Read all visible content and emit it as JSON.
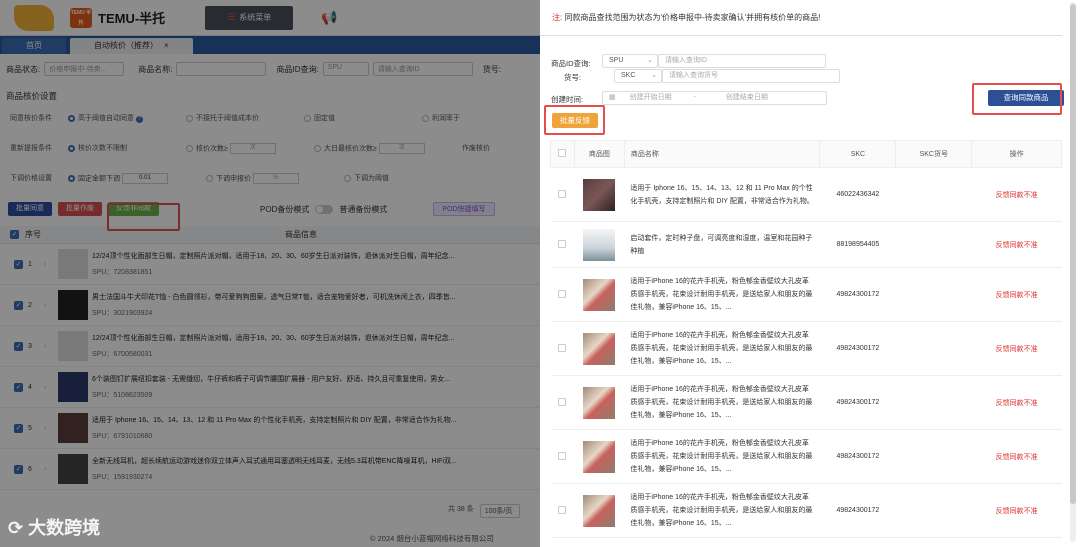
{
  "app": {
    "brand": "TEMU-半托",
    "logo_small": "TEMU 半托",
    "system_menu": "系统菜单",
    "tabs": [
      {
        "label": "首页"
      },
      {
        "label": "自动核价（推荐）",
        "close": "×"
      }
    ],
    "filters": {
      "status_label": "商品状态:",
      "status_value": "价格申报中-待卖...",
      "name_label": "商品名称:",
      "id_label": "商品ID查询:",
      "id_type": "SPU",
      "id_placeholder": "请输入查询ID",
      "sku_label": "货号:"
    },
    "settings_title": "商品核价设置",
    "config_rows": [
      {
        "label": "同意核价条件",
        "options": [
          "高于阈值自动同意",
          "不接托于阈值成本价",
          "固定值",
          "利润率于"
        ]
      },
      {
        "label": "重新提报条件",
        "options": [
          "核价次数不限制",
          "核价次数≥",
          "次",
          "大日最核价次数≥",
          "次",
          "作废核价"
        ]
      },
      {
        "label": "下调价格设置",
        "options": [
          "固定金额下调",
          "0.01",
          "下调申报价",
          "%",
          "下调为阈值"
        ]
      }
    ],
    "buttons": {
      "bulk_agree": "批量同意",
      "bulk_void": "批量作废",
      "feedback_same": "反馈非同款",
      "pod_mode_label": "POD备份模式",
      "normal_mode_label": "普通备份模式",
      "pod_quick": "POD快捷填写"
    },
    "table_head": {
      "index": "序号",
      "info": "商品信息"
    },
    "rows": [
      {
        "idx": "1",
        "title": "12/24顶个性化面部生日帽，定制照片派对帽，适用于18、20、30、60岁生日派对装饰，退休派对生日帽，周年纪念...",
        "spu": "SPU：7208381851"
      },
      {
        "idx": "2",
        "title": "男士法国斗牛犬印花T恤 - 白色圆领衫，带可爱狗狗图案，透气日常T恤，适合宠物爱好者，可机洗休闲上衣，四季皆...",
        "spu": "SPU：3021903924"
      },
      {
        "idx": "3",
        "title": "12/24顶个性化面部生日帽，定制照片派对帽，适用于18、20、30、60岁生日派对装饰，退休派对生日帽，周年纪念...",
        "spu": "SPU：6700580031"
      },
      {
        "idx": "4",
        "title": "6个装图钉扩展纽扣套装 - 无需缝纫，牛仔裤和裤子可调节腰围扩展器 - 用户友好、舒适、持久且可重复使用，男女...",
        "spu": "SPU：5108623509"
      },
      {
        "idx": "5",
        "title": "适用于 Iphone 16、15、14、13、12 和 11 Pro Max 的个性化手机壳，支持定制照片和 DIY 配置，非常适合作为礼物...",
        "spu": "SPU：6791010680"
      },
      {
        "idx": "6",
        "title": "全新无线耳机，超长续航运动游戏迷你双立体声入耳式通用耳塞透明无线耳麦，无线5.3耳机带ENC降噪耳机，HiFi双...",
        "spu": "SPU：1591930274"
      }
    ],
    "pager": {
      "total": "共 38 条",
      "per_page": "100条/页"
    },
    "footer": "© 2024 烟台小蓝帽网络科技有限公司",
    "watermark": "大数跨境"
  },
  "modal": {
    "note_prefix": "注:",
    "note": "同款商品查找范围为状态为'价格申报中-待卖家确认'并拥有核价单的商品!",
    "id_label": "商品ID查询:",
    "id_type": "SPU",
    "id_placeholder": "请输入查询ID",
    "sku_label": "货号:",
    "sku_type": "SKC",
    "sku_placeholder": "请输入查询货号",
    "created_label": "创建时间:",
    "start_placeholder": "创建开始日期",
    "range_sep": "-",
    "end_placeholder": "创建结束日期",
    "query_button": "查询同款商品",
    "feedback_button": "批量反馈",
    "columns": [
      "商品图",
      "商品名称",
      "SKC",
      "SKC货号",
      "操作"
    ],
    "rows": [
      {
        "img": "phone",
        "name": "适用于 Iphone 16、15、14、13、12 和 11 Pro Max 的个性化手机壳，支持定制照片和 DIY 配置，非常适合作为礼物。",
        "skc": "46022436342",
        "skc_no": "",
        "op": "反馈同款不准"
      },
      {
        "img": "kit",
        "name": "启动套件，定时种子盘，可调亮度和湿度，温室和花园种子种植",
        "skc": "88198954405",
        "skc_no": "",
        "op": "反馈同款不准"
      },
      {
        "img": "floral",
        "name": "适用于iPhone 16的花卉手机壳，粉色郁金香壁纹大孔皮革质感手机壳，花束设计耐用手机壳，是送给家人和朋友的最佳礼物，兼容iPhone 16、15、...",
        "skc": "49824300172",
        "skc_no": "",
        "op": "反馈同款不准"
      },
      {
        "img": "floral",
        "name": "适用于iPhone 16的花卉手机壳，粉色郁金香壁纹大孔皮革质感手机壳，花束设计耐用手机壳，是送给家人和朋友的最佳礼物，兼容iPhone 16、15、...",
        "skc": "49824300172",
        "skc_no": "",
        "op": "反馈同款不准"
      },
      {
        "img": "floral",
        "name": "适用于iPhone 16的花卉手机壳，粉色郁金香壁纹大孔皮革质感手机壳，花束设计耐用手机壳，是送给家人和朋友的最佳礼物，兼容iPhone 16、15、...",
        "skc": "49824300172",
        "skc_no": "",
        "op": "反馈同款不准"
      },
      {
        "img": "floral",
        "name": "适用于iPhone 16的花卉手机壳，粉色郁金香壁纹大孔皮革质感手机壳，花束设计耐用手机壳，是送给家人和朋友的最佳礼物，兼容iPhone 16、15、...",
        "skc": "49824300172",
        "skc_no": "",
        "op": "反馈同款不准"
      },
      {
        "img": "floral",
        "name": "适用于iPhone 16的花卉手机壳，粉色郁金香壁纹大孔皮革质感手机壳，花束设计耐用手机壳，是送给家人和朋友的最佳礼物，兼容iPhone 16、15、...",
        "skc": "49824300172",
        "skc_no": "",
        "op": "反馈同款不准"
      }
    ]
  },
  "colors": {
    "accent": "#2c4f96",
    "feedback": "#f0a33a",
    "highlight": "#e05050",
    "danger": "#e03030"
  }
}
